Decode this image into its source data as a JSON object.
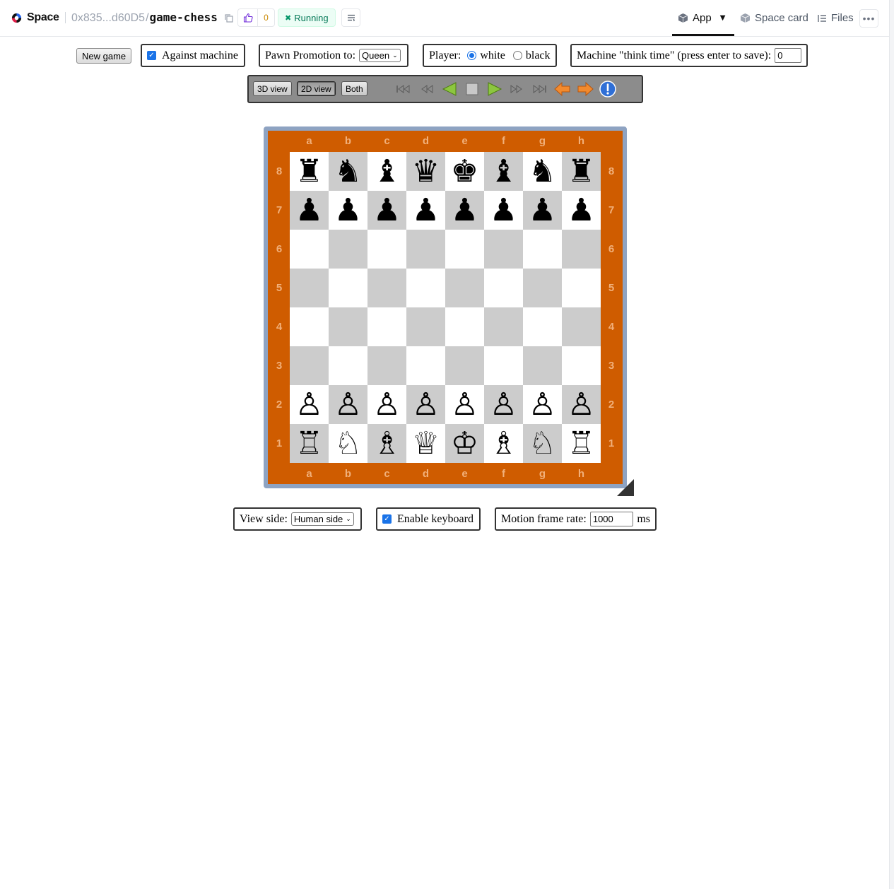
{
  "header": {
    "brand": "Space",
    "owner": "0x835...d60D5",
    "slash": "/",
    "repo": "game-chess",
    "likes": "0",
    "status": "Running",
    "tabs": {
      "app": "App",
      "card": "Space card",
      "files": "Files"
    }
  },
  "controls": {
    "new_game": "New game",
    "against_machine": "Against machine",
    "pawn_promotion_label": "Pawn Promotion to:",
    "pawn_promotion_value": "Queen",
    "player_label": "Player:",
    "player_white": "white",
    "player_black": "black",
    "think_time_label": "Machine \"think time\" (press enter to save):",
    "think_time_value": "0"
  },
  "toolbar": {
    "view3d": "3D view",
    "view2d": "2D view",
    "both": "Both"
  },
  "board": {
    "files": [
      "a",
      "b",
      "c",
      "d",
      "e",
      "f",
      "g",
      "h"
    ],
    "ranks": [
      "8",
      "7",
      "6",
      "5",
      "4",
      "3",
      "2",
      "1"
    ],
    "rows": [
      [
        "♜",
        "♞",
        "♝",
        "♛",
        "♚",
        "♝",
        "♞",
        "♜"
      ],
      [
        "♟",
        "♟",
        "♟",
        "♟",
        "♟",
        "♟",
        "♟",
        "♟"
      ],
      [
        "",
        "",
        "",
        "",
        "",
        "",
        "",
        ""
      ],
      [
        "",
        "",
        "",
        "",
        "",
        "",
        "",
        ""
      ],
      [
        "",
        "",
        "",
        "",
        "",
        "",
        "",
        ""
      ],
      [
        "",
        "",
        "",
        "",
        "",
        "",
        "",
        ""
      ],
      [
        "♙",
        "♙",
        "♙",
        "♙",
        "♙",
        "♙",
        "♙",
        "♙"
      ],
      [
        "♖",
        "♘",
        "♗",
        "♕",
        "♔",
        "♗",
        "♘",
        "♖"
      ]
    ]
  },
  "bottom": {
    "view_side_label": "View side:",
    "view_side_value": "Human side",
    "enable_keyboard": "Enable keyboard",
    "frame_rate_label": "Motion frame rate:",
    "frame_rate_value": "1000",
    "frame_rate_unit": "ms"
  }
}
